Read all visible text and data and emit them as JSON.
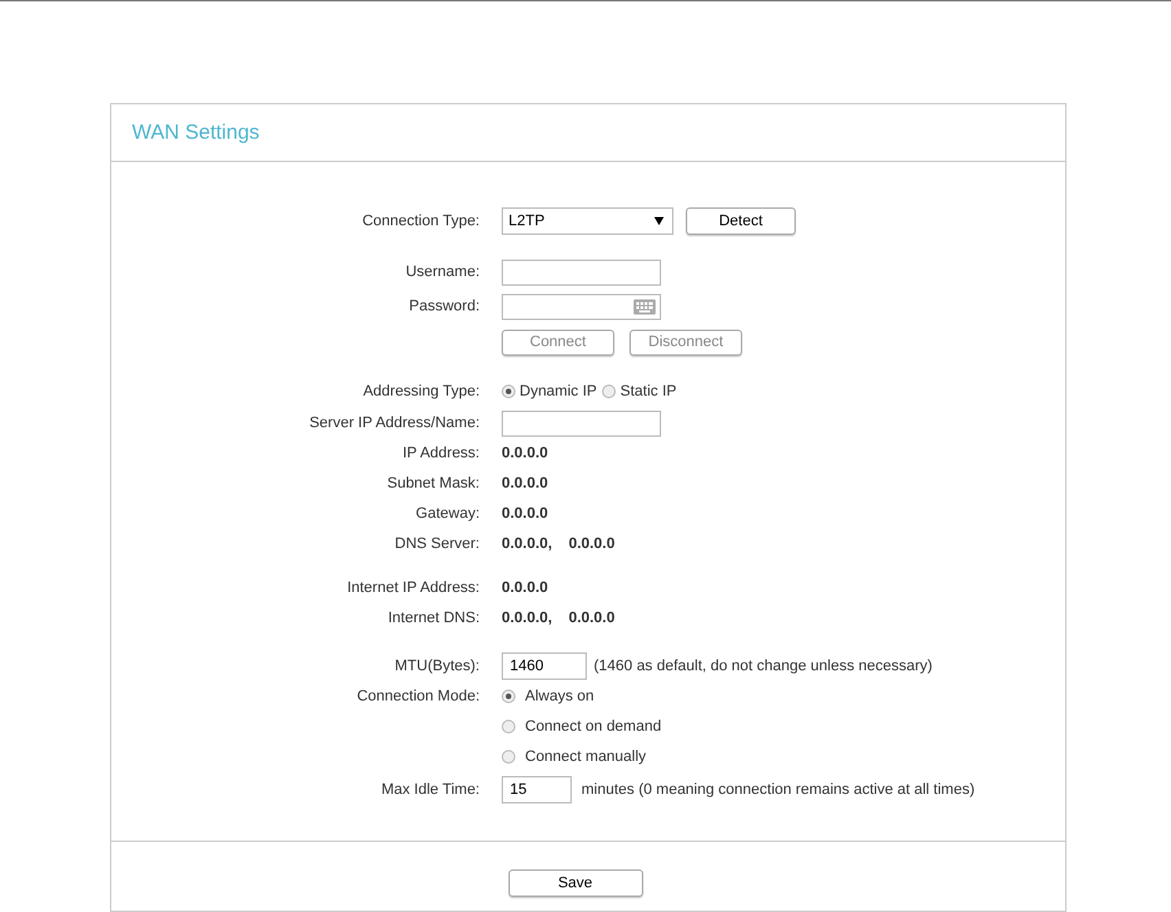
{
  "panel_title": "WAN Settings",
  "connection_type": {
    "label": "Connection Type:",
    "value": "L2TP",
    "detect_button": "Detect"
  },
  "username": {
    "label": "Username:"
  },
  "password": {
    "label": "Password:"
  },
  "connect_buttons": [
    {
      "label": "Connect",
      "disabled": true
    },
    {
      "label": "Disconnect",
      "disabled": true
    }
  ],
  "addressing_type": {
    "label": "Addressing Type:",
    "options": [
      {
        "label": "Dynamic IP",
        "selected": true
      },
      {
        "label": "Static IP",
        "selected": false
      }
    ]
  },
  "server": {
    "label": "Server IP Address/Name:"
  },
  "info_groups": [
    [
      {
        "label": "IP Address:",
        "values": [
          "0.0.0.0"
        ]
      },
      {
        "label": "Subnet Mask:",
        "values": [
          "0.0.0.0"
        ]
      },
      {
        "label": "Gateway:",
        "values": [
          "0.0.0.0"
        ]
      },
      {
        "label": "DNS Server:",
        "values": [
          "0.0.0.0,",
          "0.0.0.0"
        ]
      }
    ],
    [
      {
        "label": "Internet IP Address:",
        "values": [
          "0.0.0.0"
        ]
      },
      {
        "label": "Internet DNS:",
        "values": [
          "0.0.0.0,",
          "0.0.0.0"
        ]
      }
    ]
  ],
  "mtu": {
    "label": "MTU(Bytes):",
    "value": "1460",
    "note": "(1460 as default, do not change unless necessary)"
  },
  "connection_mode": {
    "label": "Connection Mode:",
    "options": [
      {
        "label": "Always on",
        "selected": true
      },
      {
        "label": "Connect on demand",
        "selected": false
      },
      {
        "label": "Connect manually",
        "selected": false
      }
    ]
  },
  "max_idle": {
    "label": "Max Idle Time:",
    "value": "15",
    "note": "minutes (0 meaning connection remains active at all times)"
  },
  "save_button": "Save"
}
